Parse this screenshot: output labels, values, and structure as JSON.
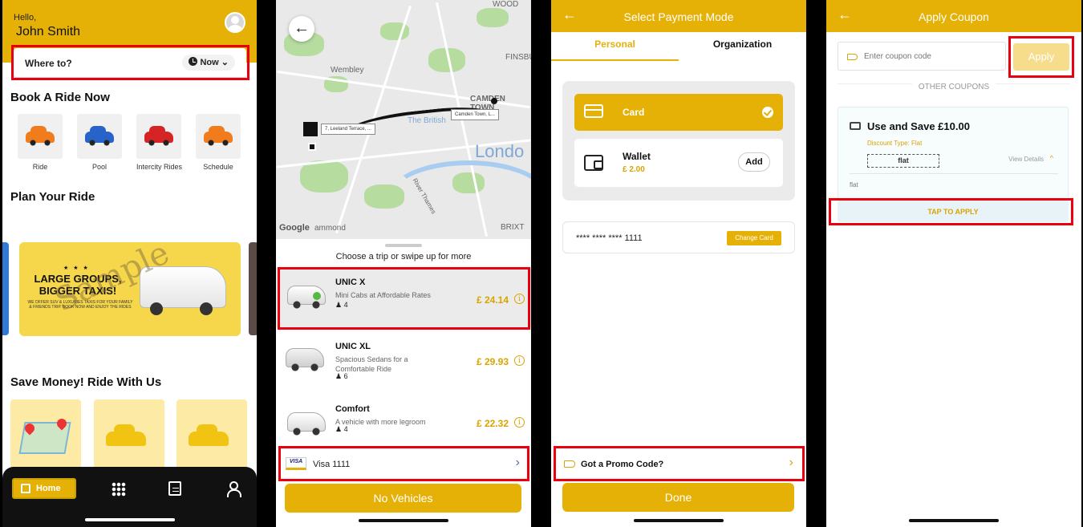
{
  "screen1": {
    "greeting": "Hello,",
    "user_name": "John Smith",
    "where_to": "Where to?",
    "time_selector": "Now",
    "book_title": "Book A Ride Now",
    "ride_options": [
      {
        "label": "Ride",
        "icon": "orange-car-icon"
      },
      {
        "label": "Pool",
        "icon": "blue-car-icon"
      },
      {
        "label": "Intercity Rides",
        "icon": "red-car-luggage-icon"
      },
      {
        "label": "Schedule",
        "icon": "car-calendar-icon"
      }
    ],
    "plan_title": "Plan Your Ride",
    "banner": {
      "headline": "LARGE GROUPS, BIGGER TAXIS!",
      "subtext": "WE OFFER SUV & LUXURIES TAXIS FOR YOUR FAMILY & FRIENDS TRIP. BOOK NOW AND ENJOY THE RIDES",
      "watermark": "Sample"
    },
    "save_title": "Save Money! Ride With Us",
    "nav": {
      "home": "Home"
    }
  },
  "screen2": {
    "map_labels": {
      "wembley": "Wembley",
      "camden": "CAMDEN TOWN",
      "finsbury": "FINSBU",
      "wood": "WOOD",
      "brixton": "BRIXT",
      "london": "Londo",
      "british": "The British",
      "thames": "River Thames",
      "tag_origin": "7, Leeland Terrace, ...",
      "tag_dest": "Camden Town, L...",
      "google": "Google",
      "hammond": "ammond"
    },
    "choose_text": "Choose a trip or swipe up for more",
    "vehicles": [
      {
        "name": "UNIC X",
        "desc": "Mini Cabs at Affordable Rates",
        "seats": "4",
        "price": "£ 24.14"
      },
      {
        "name": "UNIC XL",
        "desc": "Spacious Sedans for a Comfortable Ride",
        "seats": "6",
        "price": "£ 29.93"
      },
      {
        "name": "Comfort",
        "desc": "A vehicle with more legroom",
        "seats": "4",
        "price": "£ 22.32"
      }
    ],
    "payment": {
      "badge": "VISA",
      "label": "Visa 1111"
    },
    "cta": "No Vehicles"
  },
  "screen3": {
    "title": "Select Payment Mode",
    "tabs": [
      "Personal",
      "Organization"
    ],
    "card_label": "Card",
    "wallet_label": "Wallet",
    "wallet_amount": "£ 2.00",
    "add_label": "Add",
    "card_number": "**** **** **** 1111",
    "change_card": "Change Card",
    "promo": "Got a Promo Code?",
    "done": "Done"
  },
  "screen4": {
    "title": "Apply Coupon",
    "coupon_placeholder": "Enter coupon code",
    "apply": "Apply",
    "other_coupons": "OTHER COUPONS",
    "coupon": {
      "title": "Use and Save £10.00",
      "discount_type": "Discount Type: Flat",
      "code": "flat",
      "view_details": "View Details",
      "description": "flat"
    },
    "tap_to_apply": "TAP TO APPLY"
  },
  "colors": {
    "accent": "#e6b106",
    "highlight": "#e8000f",
    "price": "#d9a400"
  }
}
